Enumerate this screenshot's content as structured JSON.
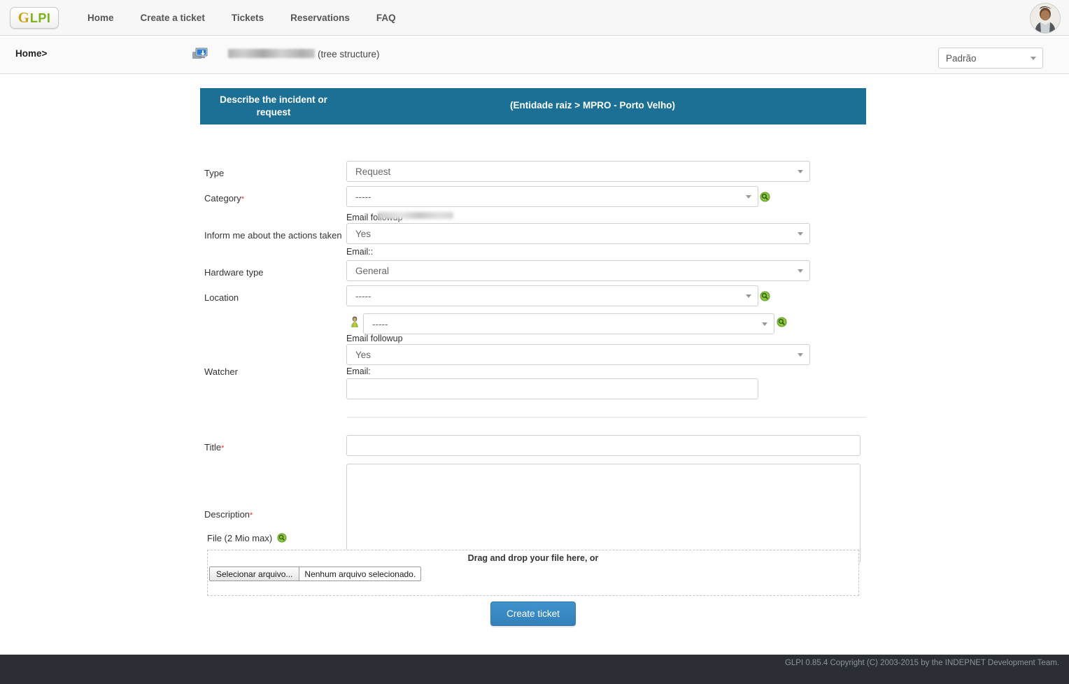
{
  "nav": {
    "logo_g": "G",
    "logo_lpi": "LPI",
    "items": [
      {
        "label": "Home"
      },
      {
        "label": "Create a ticket"
      },
      {
        "label": "Tickets"
      },
      {
        "label": "Reservations"
      },
      {
        "label": "FAQ"
      }
    ]
  },
  "breadcrumb": {
    "home": "Home>",
    "entity_name_redacted": "",
    "tree_structure": "(tree structure)",
    "profile_selected": "Padrão"
  },
  "form": {
    "header_title": "Describe the incident or request",
    "header_entity": "(Entidade raiz > MPRO - Porto Velho)",
    "type": {
      "label": "Type",
      "value": "Request"
    },
    "category": {
      "label": "Category",
      "required": "*",
      "value": "-----"
    },
    "inform": {
      "label": "Inform me about the actions taken",
      "email_followup_label": "Email followup",
      "value": "Yes",
      "email_label": "Email::",
      "email_value_redacted": ""
    },
    "hardware_type": {
      "label": "Hardware type",
      "value": "General"
    },
    "location": {
      "label": "Location",
      "value": "-----"
    },
    "watcher": {
      "label": "Watcher",
      "user_value": "-----",
      "email_followup_label": "Email followup",
      "followup_value": "Yes",
      "email_label": "Email:",
      "email_value": "",
      "email_placeholder": ""
    },
    "title": {
      "label": "Title",
      "required": "*",
      "value": "",
      "placeholder": ""
    },
    "description": {
      "label": "Description",
      "required": "*",
      "value": "",
      "placeholder": ""
    },
    "file": {
      "label": "File (2 Mio max)",
      "drag_text": "Drag and drop your file here, or",
      "select_button": "Selecionar arquivo...",
      "no_file_text": "Nenhum arquivo selecionado."
    },
    "submit_label": "Create ticket"
  },
  "footer": {
    "text": "GLPI 0.85.4 Copyright (C) 2003-2015 by the INDEPNET Development Team."
  },
  "colors": {
    "header_blue": "#1d7095",
    "button_blue": "#3c8dc5",
    "required_red": "#d9332b",
    "footer_dark": "#2b2f35"
  }
}
